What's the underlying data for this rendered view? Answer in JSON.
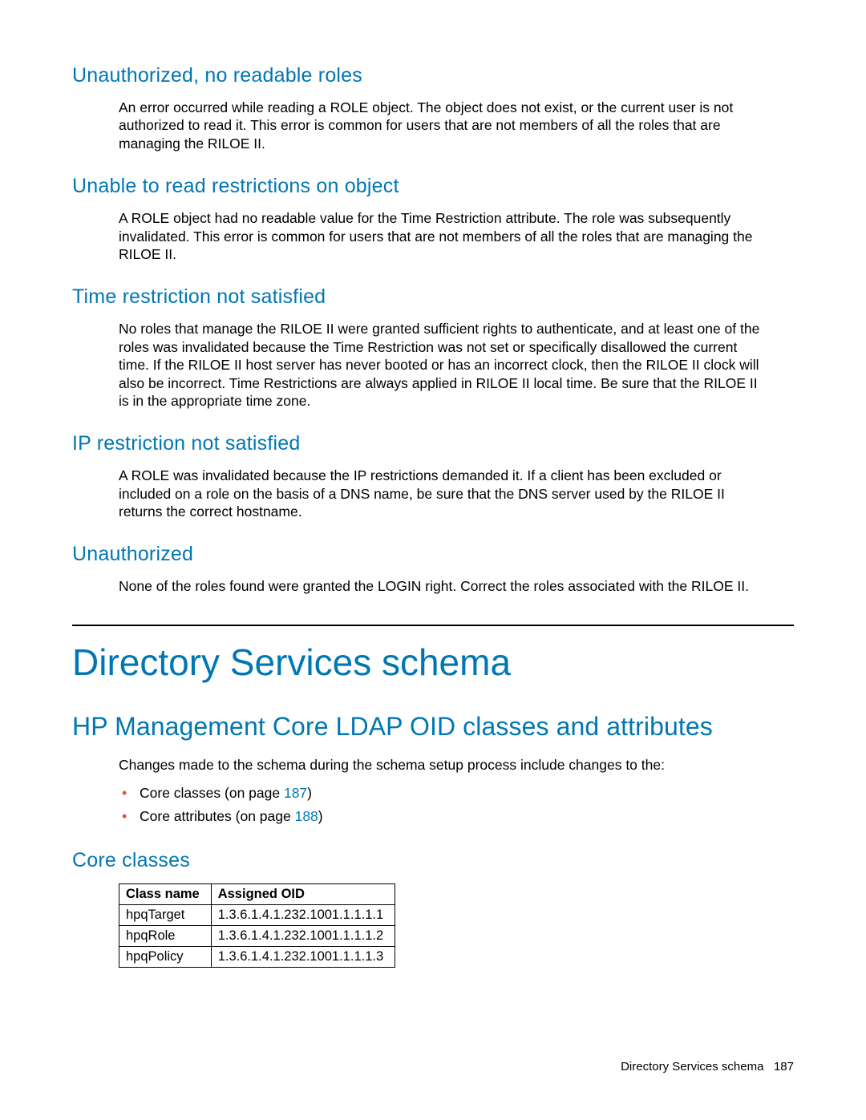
{
  "sections": [
    {
      "heading": "Unauthorized, no readable roles",
      "body": "An error occurred while reading a ROLE object. The object does not exist, or the current user is not authorized to read it. This error is common for users that are not members of all the roles that are managing the RILOE II."
    },
    {
      "heading": "Unable to read restrictions on object",
      "body": "A ROLE object had no readable value for the Time Restriction attribute. The role was subsequently invalidated. This error is common for users that are not members of all the roles that are managing the RILOE II."
    },
    {
      "heading": "Time restriction not satisfied",
      "body": "No roles that manage the RILOE II were granted sufficient rights to authenticate, and at least one of the roles was invalidated because the Time Restriction was not set or specifically disallowed the current time. If the RILOE II host server has never booted or has an incorrect clock, then the RILOE II clock will also be incorrect. Time Restrictions are always applied in RILOE II local time. Be sure that the RILOE II is in the appropriate time zone."
    },
    {
      "heading": "IP restriction not satisfied",
      "body": "A ROLE was invalidated because the IP restrictions demanded it. If a client has been excluded or included on a role on the basis of a DNS name, be sure that the DNS server used by the RILOE II returns the correct hostname."
    },
    {
      "heading": "Unauthorized",
      "body": "None of the roles found were granted the LOGIN right. Correct the roles associated with the RILOE II."
    }
  ],
  "main_title": "Directory Services schema",
  "subtitle": "HP Management Core LDAP OID classes and attributes",
  "intro": "Changes made to the schema during the schema setup process include changes to the:",
  "bullet_items": [
    {
      "prefix": "Core classes (on page ",
      "page": "187",
      "suffix": ")"
    },
    {
      "prefix": "Core attributes (on page ",
      "page": "188",
      "suffix": ")"
    }
  ],
  "core_classes_heading": "Core classes",
  "table": {
    "headers": [
      "Class name",
      "Assigned OID"
    ],
    "rows": [
      [
        "hpqTarget",
        "1.3.6.1.4.1.232.1001.1.1.1.1"
      ],
      [
        "hpqRole",
        "1.3.6.1.4.1.232.1001.1.1.1.2"
      ],
      [
        "hpqPolicy",
        "1.3.6.1.4.1.232.1001.1.1.1.3"
      ]
    ]
  },
  "footer": {
    "text": "Directory Services schema",
    "page": "187"
  }
}
